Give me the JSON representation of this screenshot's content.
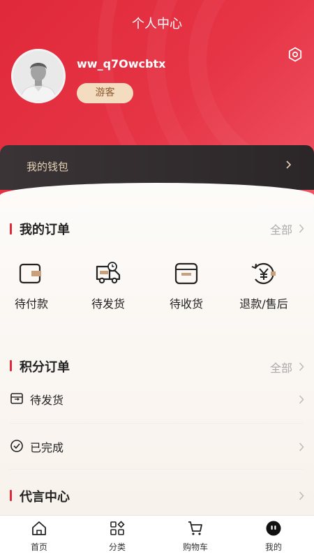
{
  "header": {
    "title": "个人中心",
    "username": "ww_q7Owcbtx",
    "role_badge": "游客",
    "background_color": "#e0293a"
  },
  "wallet": {
    "label": "我的钱包"
  },
  "my_orders": {
    "title": "我的订单",
    "see_all": "全部",
    "items": [
      {
        "label": "待付款",
        "icon": "wallet-icon"
      },
      {
        "label": "待发货",
        "icon": "delivery-truck-icon"
      },
      {
        "label": "待收货",
        "icon": "package-box-icon"
      },
      {
        "label": "退款/售后",
        "icon": "refund-yen-icon"
      }
    ]
  },
  "points_orders": {
    "title": "积分订单",
    "see_all": "全部",
    "rows": [
      {
        "label": "待发货",
        "icon": "pending-shipment-icon"
      },
      {
        "label": "已完成",
        "icon": "check-circle-icon"
      }
    ]
  },
  "ambassador": {
    "title": "代言中心"
  },
  "tabbar": {
    "items": [
      {
        "label": "首页",
        "icon": "home-icon"
      },
      {
        "label": "分类",
        "icon": "category-icon"
      },
      {
        "label": "购物车",
        "icon": "cart-icon"
      },
      {
        "label": "我的",
        "icon": "profile-icon",
        "active": true
      }
    ]
  },
  "colors": {
    "accent": "#e0293a",
    "badge": "#f4dcc0",
    "wallet_bar": "#2f2a2c"
  }
}
